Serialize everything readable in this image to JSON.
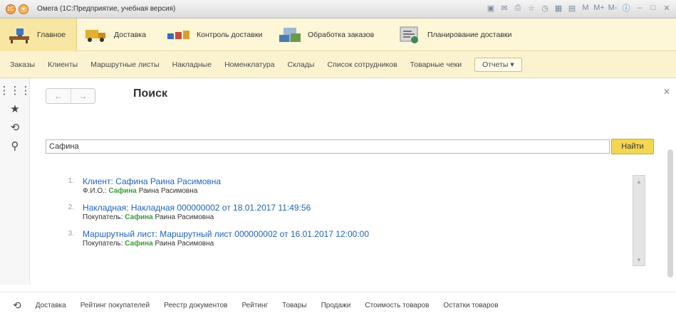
{
  "window": {
    "title": "Омега  (1С:Предприятие, учебная версия)",
    "tools": [
      "save-icon",
      "mail-icon",
      "preview-icon",
      "favorite-icon",
      "history-icon",
      "calendar-icon",
      "calc-icon",
      "M",
      "M+",
      "M-",
      "info-icon",
      "minimize-icon",
      "maximize-icon",
      "close-icon"
    ]
  },
  "sections": [
    {
      "label": "Главное",
      "icon": "desk-icon",
      "active": true
    },
    {
      "label": "Доставка",
      "icon": "truck-icon"
    },
    {
      "label": "Контроль доставки",
      "icon": "control-icon"
    },
    {
      "label": "Обработка заказов",
      "icon": "orders-icon"
    },
    {
      "label": "Планирование доставки",
      "icon": "planning-icon"
    }
  ],
  "functions": [
    "Заказы",
    "Клиенты",
    "Маршрутные листы",
    "Накладные",
    "Номенклатура",
    "Склады",
    "Список сотрудников",
    "Товарные чеки"
  ],
  "functions_dropdown": "Отчеты",
  "page": {
    "title": "Поиск",
    "search_value": "Сафина",
    "find_label": "Найти"
  },
  "results": [
    {
      "num": "1.",
      "link": "Клиент: Сафина Раина Расимовна",
      "label": "Ф.И.О.:",
      "hl": "Сафина",
      "rest": "Раина Расимовна"
    },
    {
      "num": "2.",
      "link": "Накладная: Накладная 000000002 от 18.01.2017 11:49:56",
      "label": "Покупатель:",
      "hl": "Сафина",
      "rest": "Раина Расимовна"
    },
    {
      "num": "3.",
      "link": "Маршрутный лист: Маршрутный лист 000000002 от 16.01.2017 12:00:00",
      "label": "Покупатель:",
      "hl": "Сафина",
      "rest": "Раина Расимовна"
    }
  ],
  "bottom": [
    "Доставка",
    "Рейтинг покупателей",
    "Реестр документов",
    "Рейтинг",
    "Товары",
    "Продажи",
    "Стоимость товаров",
    "Остатки товаров"
  ]
}
